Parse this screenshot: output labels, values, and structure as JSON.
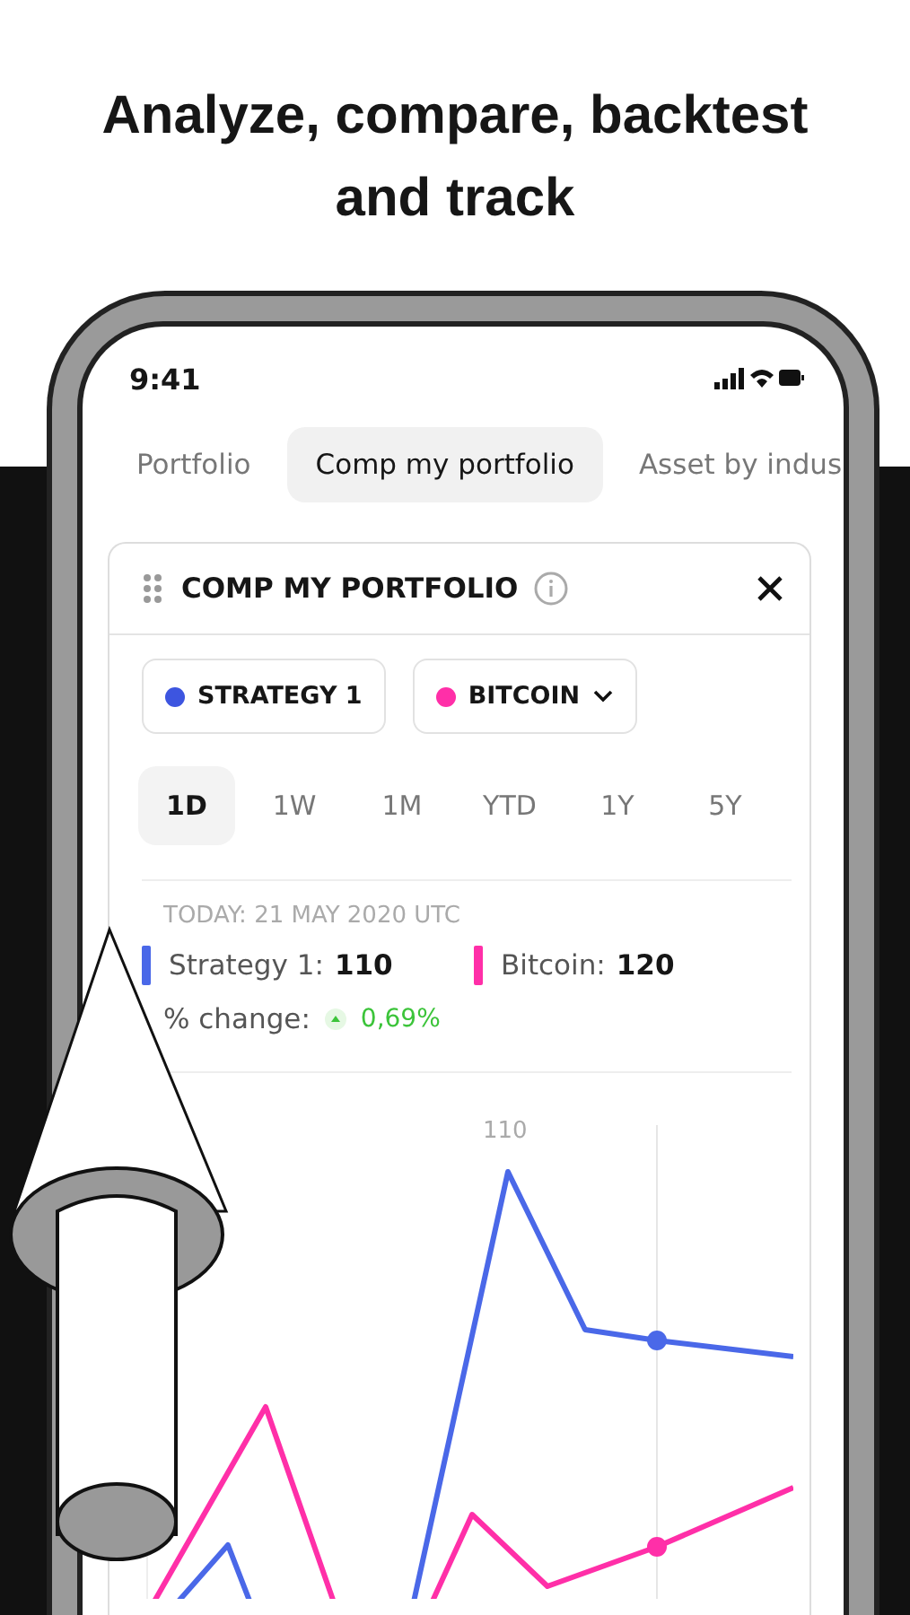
{
  "headline": "Analyze, compare, backtest and track",
  "status_bar": {
    "time": "9:41"
  },
  "tabs": [
    {
      "label": "Portfolio",
      "selected": false
    },
    {
      "label": "Comp my portfolio",
      "selected": true
    },
    {
      "label": "Asset by indus",
      "selected": false
    }
  ],
  "card": {
    "title": "COMP MY PORTFOLIO",
    "chips": [
      {
        "label": "STRATEGY 1",
        "color": "#3d55e0",
        "dropdown": false
      },
      {
        "label": "BITCOIN",
        "color": "#ff2fa8",
        "dropdown": true
      }
    ],
    "periods": [
      {
        "label": "1D",
        "selected": true
      },
      {
        "label": "1W",
        "selected": false
      },
      {
        "label": "1M",
        "selected": false
      },
      {
        "label": "YTD",
        "selected": false
      },
      {
        "label": "1Y",
        "selected": false
      },
      {
        "label": "5Y",
        "selected": false
      }
    ],
    "date": "TODAY: 21 MAY 2020 UTC",
    "legend": [
      {
        "label": "Strategy 1:",
        "value": "110",
        "color": "#4a68e8"
      },
      {
        "label": "Bitcoin:",
        "value": "120",
        "color": "#ff2fa8"
      }
    ],
    "change": {
      "label": "% change:",
      "value": "0,69%"
    },
    "chart": {
      "peak_label": "110"
    }
  }
}
